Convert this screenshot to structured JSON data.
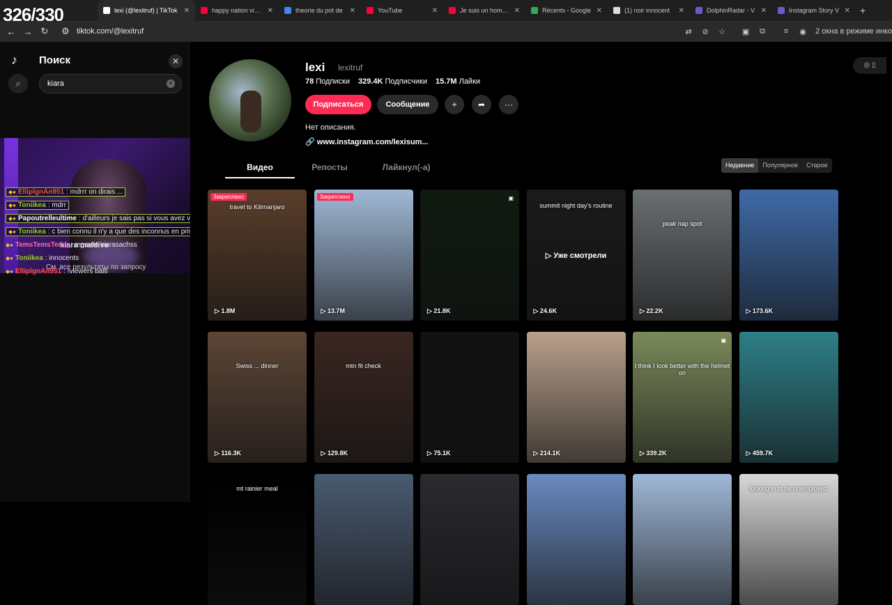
{
  "overlay": {
    "counter": "326/330"
  },
  "browser": {
    "tabs": [
      {
        "title": "lexi (@lexitruf) | TikTok",
        "color": "#ffffff",
        "active": true
      },
      {
        "title": "happy nation vibes",
        "color": "#ff0033",
        "active": false
      },
      {
        "title": "theorie du pot de",
        "color": "#4285f4",
        "active": false
      },
      {
        "title": "YouTube",
        "color": "#ff0033",
        "active": false
      },
      {
        "title": "Je suis un homme",
        "color": "#ff0033",
        "active": false
      },
      {
        "title": "Récents - Google",
        "color": "#34a853",
        "active": false
      },
      {
        "title": "(1) noir innocent",
        "color": "#dddddd",
        "active": false
      },
      {
        "title": "DolphinRadar - V",
        "color": "#6a5acd",
        "active": false
      },
      {
        "title": "Instagram Story V",
        "color": "#6a5acd",
        "active": false
      }
    ],
    "url": "tiktok.com/@lexitruf",
    "incognito_text": "2 окна в режиме инко"
  },
  "sidebar": {
    "search_title": "Поиск",
    "search_value": "kiara",
    "suggestion": "kiara maldive",
    "see_all": "См. все результаты по запросу"
  },
  "chat": [
    {
      "user": "ElliplgnAn951",
      "msg": ": mdrrr on dirais ...",
      "color": "#ff4d4d",
      "boxed": true
    },
    {
      "user": "Toniikea",
      "msg": ": mdrr",
      "color": "#9acd32",
      "boxed": true
    },
    {
      "user": "Papoutrelleultime",
      "msg": ": d'ailleurs je sais pas si vous avez vu mais l'avocat...",
      "color": "#ffffff",
      "boxed": true
    },
    {
      "user": "Toniikea",
      "msg": ": c bien connu il n'y a que des inconnus en prison",
      "color": "#9acd32",
      "boxed": true
    },
    {
      "user": "TemsTemsTems",
      "msg": ": regarde kiarasachss",
      "color": "#ff69b4",
      "boxed": false
    },
    {
      "user": "Toniikea",
      "msg": ": innocents",
      "color": "#9acd32",
      "boxed": false
    },
    {
      "user": "ElliplgnAn951",
      "msg": ": !viewers balti",
      "color": "#ff4d4d",
      "boxed": false
    }
  ],
  "profile": {
    "username": "lexi",
    "handle": "lexitruf",
    "following_count": "78",
    "following_label": "Подписки",
    "followers_count": "329.4K",
    "followers_label": "Подписчики",
    "likes_count": "15.7M",
    "likes_label": "Лайки",
    "follow_label": "Подписаться",
    "message_label": "Сообщение",
    "bio": "Нет описания.",
    "link": "www.instagram.com/lexisum..."
  },
  "content_tabs": [
    "Видео",
    "Репосты",
    "Лайкнул(-а)"
  ],
  "sort_options": [
    "Недавние",
    "Популярное",
    "Старое"
  ],
  "videos": [
    {
      "views": "1.8M",
      "caption": "travel to Kilimanjaro",
      "pinned": "Закреплено",
      "bg": "#5a3d2b"
    },
    {
      "views": "13.7M",
      "caption": "",
      "pinned": "Закреплено",
      "bg": "#9fb8d6"
    },
    {
      "views": "21.8K",
      "caption": "",
      "pinned": "",
      "bg": "#0f1a10"
    },
    {
      "views": "24.6K",
      "caption": "summit night day's routine",
      "pinned": "",
      "bg": "#1a1a1a",
      "watched": "Уже смотрели"
    },
    {
      "views": "22.2K",
      "caption": "peak nap spot",
      "pinned": "",
      "bg": "#6a6f72"
    },
    {
      "views": "173.6K",
      "caption": "",
      "pinned": "",
      "bg": "#3f6aa8"
    },
    {
      "views": "116.3K",
      "caption": "Swiss ... dinner",
      "pinned": "",
      "bg": "#5c4636"
    },
    {
      "views": "129.8K",
      "caption": "mtn fit check",
      "pinned": "",
      "bg": "#3a2620"
    },
    {
      "views": "75.1K",
      "caption": "",
      "pinned": "",
      "bg": "#121212"
    },
    {
      "views": "214.1K",
      "caption": "",
      "pinned": "",
      "bg": "#b9a08c"
    },
    {
      "views": "339.2K",
      "caption": "I think I look better with the helmet on",
      "pinned": "",
      "bg": "#7a8a5a"
    },
    {
      "views": "459.7K",
      "caption": "",
      "pinned": "",
      "bg": "#2e7f88"
    },
    {
      "views": "",
      "caption": "mt rainier meal",
      "pinned": "",
      "bg": "#000000"
    },
    {
      "views": "",
      "caption": "",
      "pinned": "",
      "bg": "#4a5a70"
    },
    {
      "views": "",
      "caption": "",
      "pinned": "",
      "bg": "#2a2a30"
    },
    {
      "views": "",
      "caption": "",
      "pinned": "",
      "bg": "#6a8ac0"
    },
    {
      "views": "",
      "caption": "",
      "pinned": "",
      "bg": "#a0b8d8"
    },
    {
      "views": "",
      "caption": "locking in to be unemployed",
      "pinned": "",
      "bg": "#d8d8d8"
    }
  ]
}
